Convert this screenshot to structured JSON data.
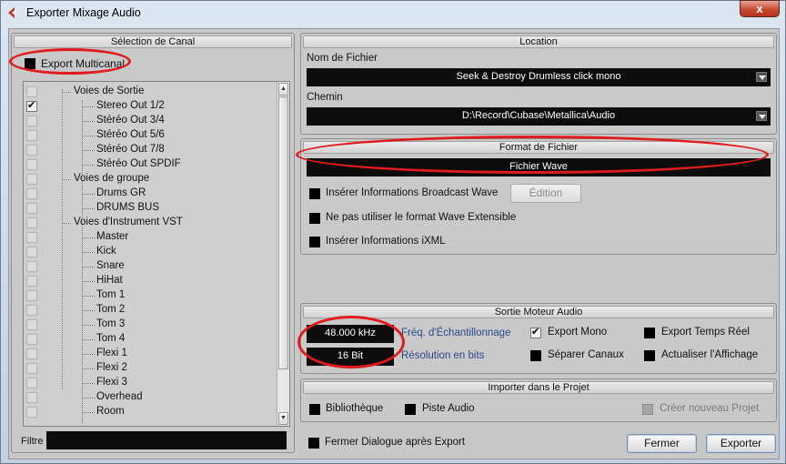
{
  "window": {
    "title": "Exporter Mixage Audio",
    "close_label": "x"
  },
  "channel_panel": {
    "header": "Sélection de Canal",
    "export_multicanal_label": "Export Multicanal",
    "tree": [
      {
        "label": "Voies de Sortie",
        "kind": "group",
        "checked": false
      },
      {
        "label": "Stereo Out 1/2",
        "kind": "item",
        "checked": true
      },
      {
        "label": "Stéréo Out 3/4",
        "kind": "item",
        "checked": false
      },
      {
        "label": "Stéréo Out 5/6",
        "kind": "item",
        "checked": false
      },
      {
        "label": "Stéréo Out 7/8",
        "kind": "item",
        "checked": false
      },
      {
        "label": "Stéréo Out SPDIF",
        "kind": "item",
        "checked": false
      },
      {
        "label": "Voies de groupe",
        "kind": "group",
        "checked": false
      },
      {
        "label": "Drums GR",
        "kind": "item",
        "checked": false
      },
      {
        "label": "DRUMS BUS",
        "kind": "item",
        "checked": false
      },
      {
        "label": "Voies d'Instrument VST",
        "kind": "group",
        "checked": false
      },
      {
        "label": "Master",
        "kind": "item",
        "checked": false
      },
      {
        "label": "Kick",
        "kind": "item",
        "checked": false
      },
      {
        "label": "Snare",
        "kind": "item",
        "checked": false
      },
      {
        "label": "HiHat",
        "kind": "item",
        "checked": false
      },
      {
        "label": "Tom  1",
        "kind": "item",
        "checked": false
      },
      {
        "label": "Tom  2",
        "kind": "item",
        "checked": false
      },
      {
        "label": "Tom  3",
        "kind": "item",
        "checked": false
      },
      {
        "label": "Tom  4",
        "kind": "item",
        "checked": false
      },
      {
        "label": "Flexi  1",
        "kind": "item",
        "checked": false
      },
      {
        "label": "Flexi  2",
        "kind": "item",
        "checked": false
      },
      {
        "label": "Flexi  3",
        "kind": "item",
        "checked": false
      },
      {
        "label": "Overhead",
        "kind": "item",
        "checked": false
      },
      {
        "label": "Room",
        "kind": "item",
        "checked": false
      }
    ],
    "filter_label": "Filtre",
    "filter_value": ""
  },
  "location": {
    "header": "Location",
    "filename_label": "Nom de Fichier",
    "filename_value": "Seek & Destroy Drumless click mono",
    "path_label": "Chemin",
    "path_value": "D:\\Record\\Cubase\\Metallica\\Audio"
  },
  "format": {
    "header": "Format de Fichier",
    "value": "Fichier Wave",
    "broadcast_label": "Insérer Informations Broadcast Wave",
    "edition_label": "Édition",
    "no_extensible_label": "Ne pas utiliser le format Wave Extensible",
    "ixml_label": "Insérer Informations iXML"
  },
  "engine": {
    "header": "Sortie Moteur Audio",
    "sample_rate_value": "48.000 kHz",
    "sample_rate_label": "Fréq. d'Échantillonnage",
    "bit_depth_value": "16 Bit",
    "bit_depth_label": "Résolution en bits",
    "export_mono_label": "Export Mono",
    "export_mono_checked": true,
    "export_realtime_label": "Export Temps Réel",
    "split_channels_label": "Séparer Canaux",
    "refresh_display_label": "Actualiser l'Affichage"
  },
  "import": {
    "header": "Importer dans le Projet",
    "library_label": "Bibliothèque",
    "audio_track_label": "Piste Audio",
    "new_project_label": "Créer nouveau Projet"
  },
  "footer": {
    "close_after_label": "Fermer Dialogue après Export",
    "close_button": "Fermer",
    "export_button": "Exporter"
  },
  "colors": {
    "annotation_red": "#e01b1b",
    "field_bg": "#0c0c0c",
    "label_blue": "#2a4a8a"
  }
}
